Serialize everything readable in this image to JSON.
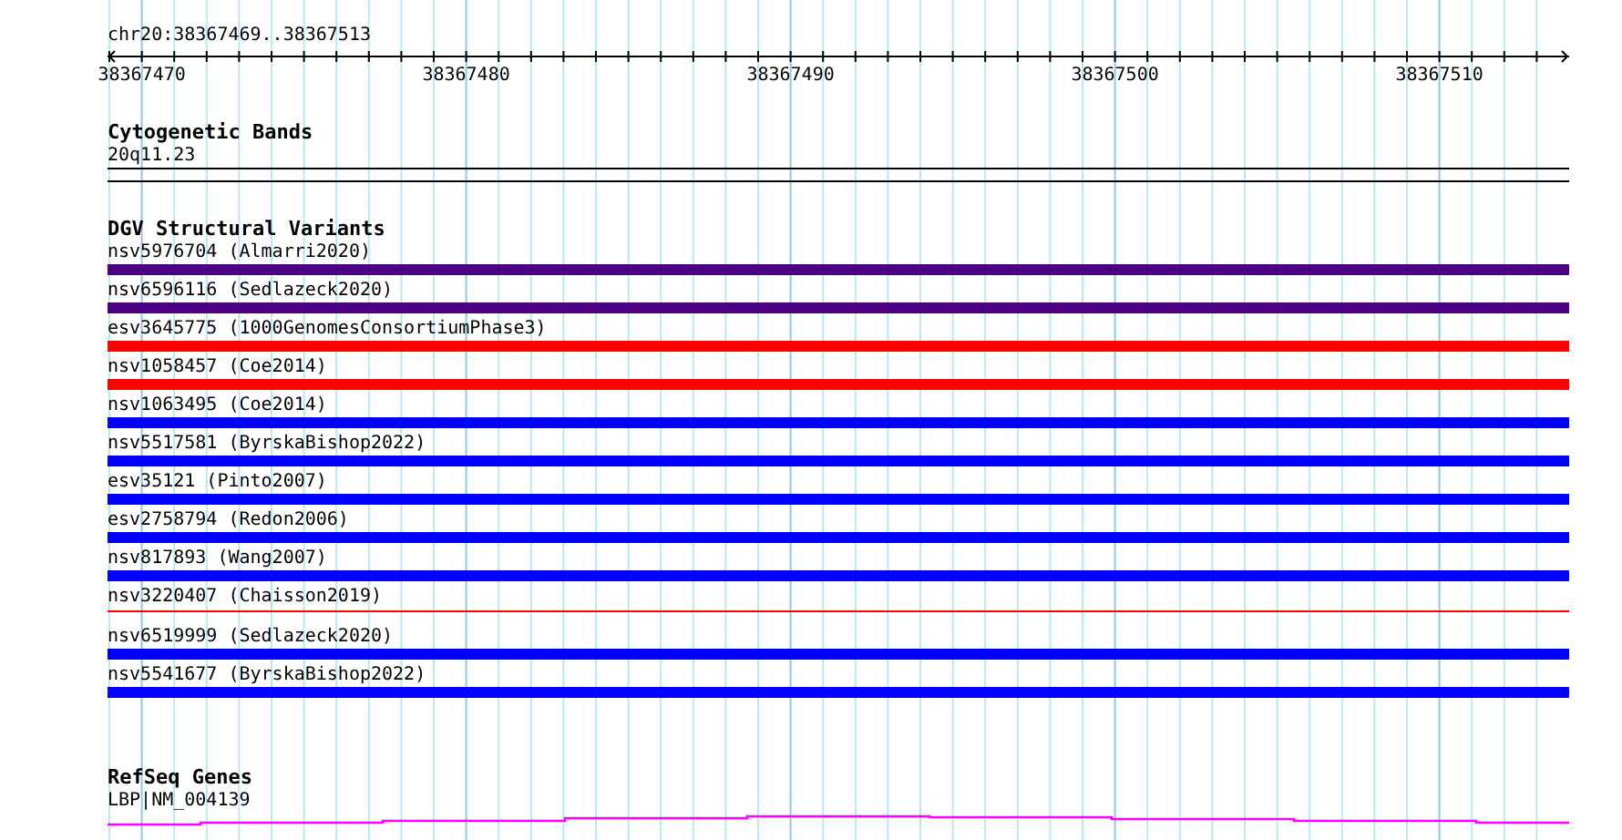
{
  "ruler": {
    "title": "chr20:38367469..38367513",
    "tick_labels": [
      "38367470",
      "38367480",
      "38367490",
      "38367500",
      "38367510"
    ]
  },
  "cytogenetic_bands": {
    "title": "Cytogenetic Bands",
    "band": "20q11.23"
  },
  "dgv_structural_variants": {
    "title": "DGV Structural Variants",
    "variants": [
      {
        "label": "nsv5976704 (Almarri2020)",
        "color": "#4b0082",
        "kind": "bar"
      },
      {
        "label": "nsv6596116 (Sedlazeck2020)",
        "color": "#4b0082",
        "kind": "bar"
      },
      {
        "label": "esv3645775 (1000GenomesConsortiumPhase3)",
        "color": "#ff0000",
        "kind": "bar"
      },
      {
        "label": "nsv1058457 (Coe2014)",
        "color": "#ff0000",
        "kind": "bar"
      },
      {
        "label": "nsv1063495 (Coe2014)",
        "color": "#0000ff",
        "kind": "bar"
      },
      {
        "label": "nsv5517581 (ByrskaBishop2022)",
        "color": "#0000ff",
        "kind": "bar"
      },
      {
        "label": "esv35121 (Pinto2007)",
        "color": "#0000ff",
        "kind": "bar"
      },
      {
        "label": "esv2758794 (Redon2006)",
        "color": "#0000ff",
        "kind": "bar"
      },
      {
        "label": "nsv817893 (Wang2007)",
        "color": "#0000ff",
        "kind": "bar"
      },
      {
        "label": "nsv3220407 (Chaisson2019)",
        "color": "#ff0000",
        "kind": "line"
      },
      {
        "label": "nsv6519999 (Sedlazeck2020)",
        "color": "#0000ff",
        "kind": "bar"
      },
      {
        "label": "nsv5541677 (ByrskaBishop2022)",
        "color": "#0000ff",
        "kind": "bar"
      }
    ]
  },
  "refseq_genes": {
    "title": "RefSeq Genes",
    "gene": "LBP|NM_004139"
  }
}
